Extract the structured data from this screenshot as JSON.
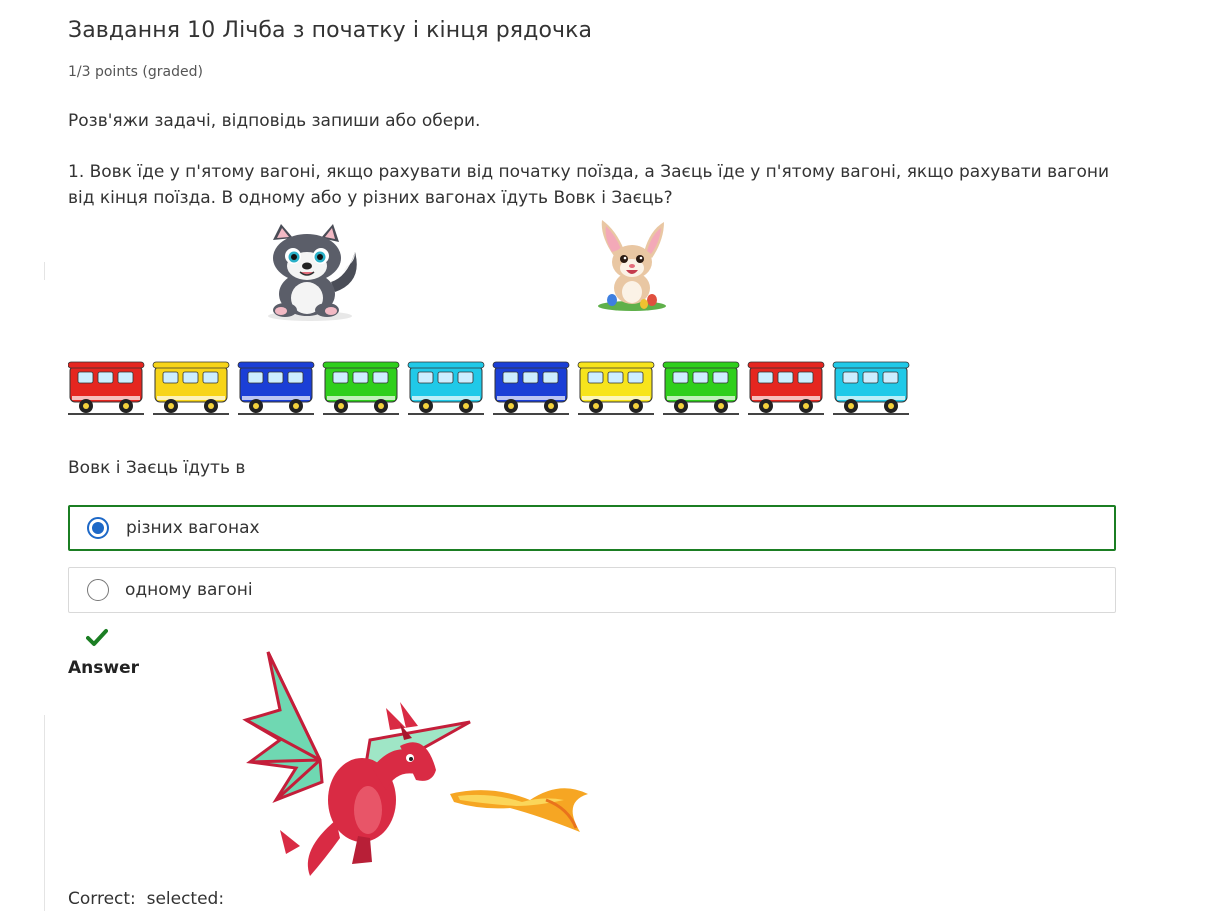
{
  "problem": {
    "title": "Завдання 10 Лічба з початку і кінця рядочка",
    "points": "1/3 points (graded)",
    "instruction": "Розв'яжи задачі, відповідь запиши або обери.",
    "question": "1. Вовк їде у п'ятому вагоні, якщо рахувати від початку поїзда, а Заєць їде у п'ятому вагоні, якщо рахувати вагони від кінця поїзда. В одному або у різних вагонах їдуть Вовк і Заєць?",
    "prompt": "Вовк і Заєць їдуть в"
  },
  "illustrations": {
    "wolf": "wolf-cartoon",
    "rabbit": "rabbit-cartoon",
    "dragon": "dragon-breathing-fire",
    "train_car_colors": [
      "#e52620",
      "#f7d418",
      "#1b3fd6",
      "#2fcf1c",
      "#20c9e8",
      "#1b3fd6",
      "#f7e41c",
      "#2fcf1c",
      "#e52620",
      "#20c9e8"
    ]
  },
  "options": [
    {
      "label": "різних вагонах",
      "selected": true
    },
    {
      "label": "одному вагоні",
      "selected": false
    }
  ],
  "feedback": {
    "status_icon": "checkmark-icon",
    "status_color": "#1b7e23",
    "answer_label": "Answer",
    "correct_label": "Correct:  selected:"
  },
  "colors": {
    "selected_border": "#1b7e23",
    "radio_selected": "#1d68c7"
  }
}
